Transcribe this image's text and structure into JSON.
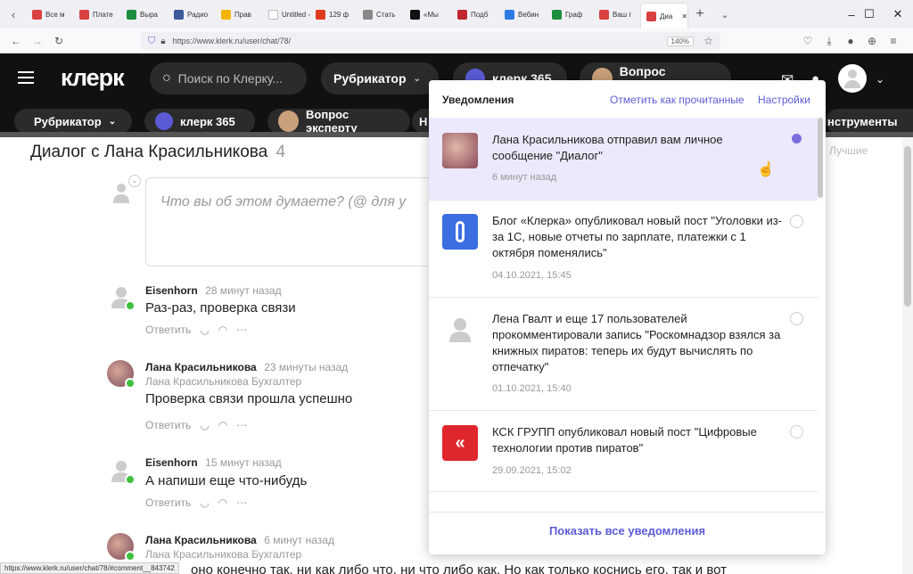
{
  "browser": {
    "tabs": [
      {
        "label": "Все м",
        "color": "#d94040"
      },
      {
        "label": "Плате",
        "color": "#d94040"
      },
      {
        "label": "Выра",
        "color": "#1e8e3e"
      },
      {
        "label": "Радио",
        "color": "#3a5a99"
      },
      {
        "label": "Прав",
        "color": "#f4b400"
      },
      {
        "label": "Untitled -",
        "color": "#ffffff"
      },
      {
        "label": "129 ф",
        "color": "#e03a1e"
      },
      {
        "label": "Стать",
        "color": "#888888"
      },
      {
        "label": "«Мы",
        "color": "#111111"
      },
      {
        "label": "Подб",
        "color": "#c0262d"
      },
      {
        "label": "Вебин",
        "color": "#2c7be5"
      },
      {
        "label": "Граф",
        "color": "#1e8e3e"
      },
      {
        "label": "Ваш г",
        "color": "#d94040"
      },
      {
        "label": "Диа",
        "color": "#d94040"
      }
    ],
    "url": "https://www.klerk.ru/user/chat/78/",
    "zoom": "140%",
    "status_url": "https://www.klerk.ru/user/chat/78/#comment__843742"
  },
  "site": {
    "logo": "клерк",
    "search_placeholder": "Поиск по Клерку...",
    "rubricator": "Рубрикатор",
    "klerk365": "клерк 365",
    "expert": "Вопрос эксперту",
    "tools": "нструменты",
    "partial_letter": "Н"
  },
  "chat": {
    "title": "Диалог с Лана Красильникова",
    "count": "4",
    "input_placeholder": "Что вы об этом думаете? (@ для у",
    "best_label": "Лучшие",
    "reply_label": "Ответить",
    "comments": [
      {
        "author": "Eisenhorn",
        "time": "28 минут назад",
        "role": "",
        "text": "Раз-раз, проверка связи"
      },
      {
        "author": "Лана Красильникова",
        "time": "23 минуты назад",
        "role": "Лана Красильникова  Бухгалтер",
        "text": "Проверка связи прошла успешно"
      },
      {
        "author": "Eisenhorn",
        "time": "15 минут назад",
        "role": "",
        "text": "А напиши еще что-нибудь"
      },
      {
        "author": "Лана Красильникова",
        "time": "6 минут назад",
        "role": "Лана Красильникова  Бухгалтер",
        "text": "оно конечно так, ни как либо что, ни что либо как. Но как только коснись его, так и вот"
      }
    ]
  },
  "notifications": {
    "title": "Уведомления",
    "mark_read": "Отметить как прочитанные",
    "settings": "Настройки",
    "show_all": "Показать все уведомления",
    "items": [
      {
        "text": "Лана Красильникова отправил вам личное сообщение \"Диалог\"",
        "date": "6 минут назад",
        "unread": true
      },
      {
        "text": "Блог «Клерка» опубликовал новый пост \"Уголовки из-за 1С, новые отчеты по зарплате, платежки с 1 октября поменялись\"",
        "date": "04.10.2021, 15:45",
        "unread": false
      },
      {
        "text": "Лена Гвалт и еще 17 пользователей прокомментировали запись \"Роскомнадзор взялся за книжных пиратов: теперь их будут вычислять по отпечатку\"",
        "date": "01.10.2021, 15:40",
        "unread": false
      },
      {
        "text": "КСК ГРУПП опубликовал новый пост \"Цифровые технологии против пиратов\"",
        "date": "29.09.2021, 15:02",
        "unread": false
      }
    ]
  },
  "colors": {
    "accent": "#5b5bd6",
    "unread_bg": "#ebe9fb",
    "online": "#3ec03e"
  }
}
